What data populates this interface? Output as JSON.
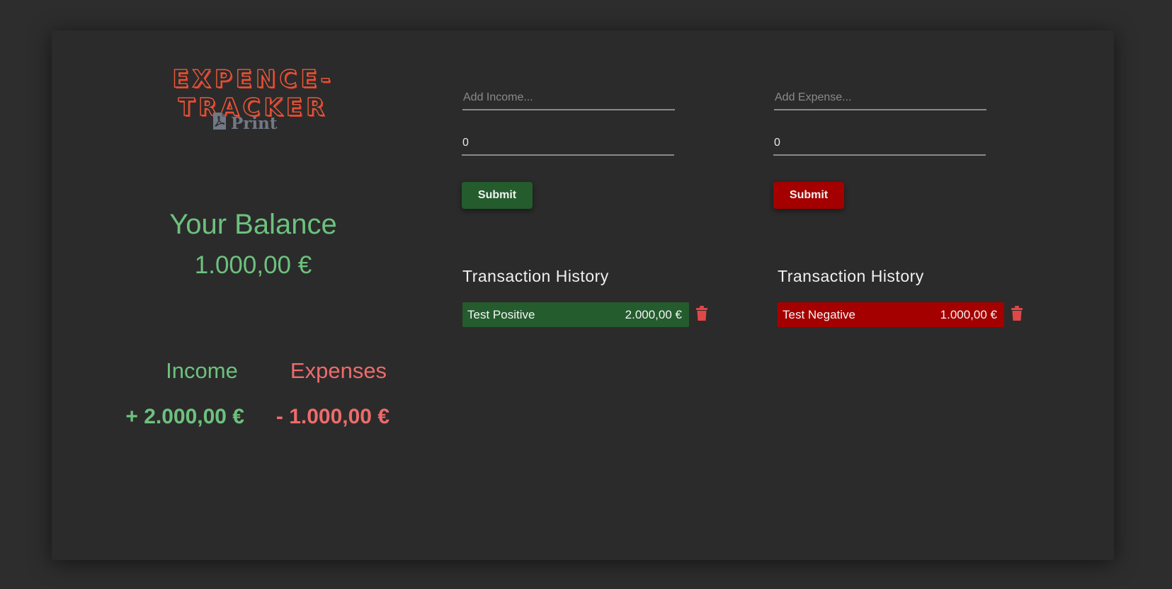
{
  "app": {
    "title": "EXPENCE-TRACKER",
    "print_label": "Print"
  },
  "balance": {
    "label": "Your Balance",
    "value": "1.000,00 €"
  },
  "summary": {
    "income_label": "Income",
    "expenses_label": "Expenses",
    "income_value": "+ 2.000,00 €",
    "expenses_value": "- 1.000,00 €"
  },
  "income_form": {
    "name_placeholder": "Add Income...",
    "amount_value": "0",
    "submit_label": "Submit",
    "history_title": "Transaction History",
    "transactions": [
      {
        "name": "Test Positive",
        "amount": "2.000,00 €"
      }
    ]
  },
  "expense_form": {
    "name_placeholder": "Add Expense...",
    "amount_value": "0",
    "submit_label": "Submit",
    "history_title": "Transaction History",
    "transactions": [
      {
        "name": "Test Negative",
        "amount": "1.000,00 €"
      }
    ]
  },
  "colors": {
    "income": "#245c2e",
    "expense": "#a40000",
    "income_text": "#6dc17e",
    "expense_text": "#ee6b6b",
    "title": "#f0583a",
    "trash": "#e04848"
  },
  "icons": {
    "print": "file-pdf-icon",
    "delete": "trash-icon"
  }
}
